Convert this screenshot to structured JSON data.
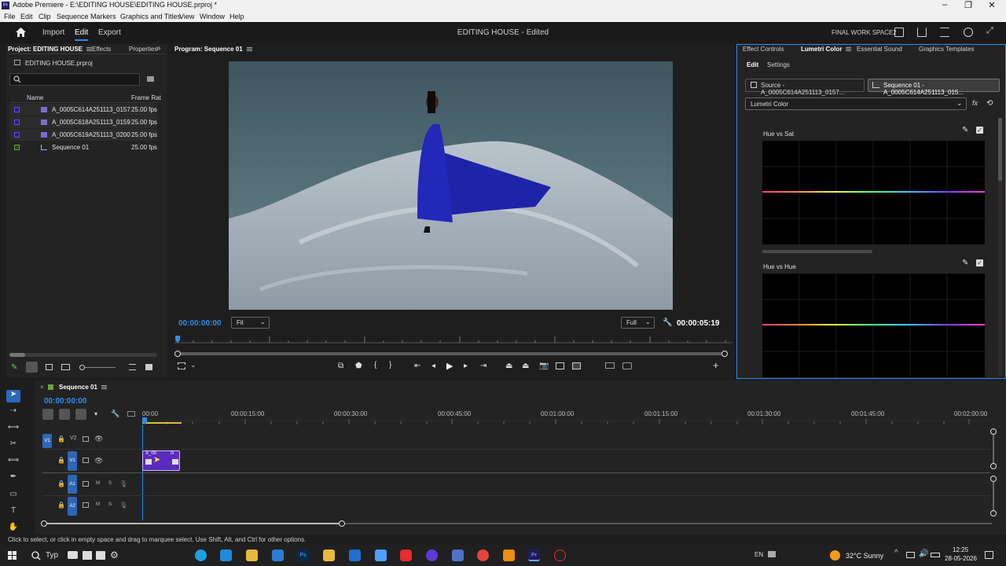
{
  "titlebar": {
    "app_icon": "Pr",
    "title": "Adobe Premiere - E:\\EDITING HOUSE\\EDITING HOUSE.prproj *"
  },
  "menubar": [
    "File",
    "Edit",
    "Clip",
    "Sequence",
    "Markers",
    "Graphics and Titles",
    "View",
    "Window",
    "Help"
  ],
  "header": {
    "nav": [
      "Import",
      "Edit",
      "Export"
    ],
    "active": "Edit",
    "project_title": "EDITING HOUSE",
    "project_state": "- Edited",
    "workspace": "FINAL WORK SPACE2"
  },
  "project_panel": {
    "tabs": [
      "Project: EDITING HOUSE",
      "Effects",
      "Properties"
    ],
    "file": "EDITING HOUSE.prproj",
    "columns": {
      "name": "Name",
      "frame_rate": "Frame Rat"
    },
    "items": [
      {
        "name": "A_0005C614A251113_0157",
        "fps": "25.00 fps"
      },
      {
        "name": "A_0005C618A251113_0159",
        "fps": "25.00 fps"
      },
      {
        "name": "A_0005C619A251113_0200",
        "fps": "25.00 fps"
      },
      {
        "name": "Sequence 01",
        "fps": "25.00 fps"
      }
    ]
  },
  "program_monitor": {
    "title": "Program: Sequence 01",
    "timecode": "00:00:00:00",
    "fit": "Fit",
    "quality": "Full",
    "duration": "00:00:05:19"
  },
  "lumetri": {
    "tabs": [
      "Effect Controls",
      "Lumetri Color",
      "Essential Sound",
      "Graphics Templates"
    ],
    "subtabs": [
      "Edit",
      "Settings"
    ],
    "source_tab": "Source - A_0005C614A251113_0157...",
    "sequence_tab": "Sequence 01 - A_0005C614A251113_015...",
    "effect": "Lumetri Color",
    "curves": [
      "Hue vs Sat",
      "Hue vs Hue"
    ]
  },
  "timeline": {
    "sequence": "Sequence 01",
    "timecode": "00:00:00:00",
    "ruler": [
      "00:00",
      "00:00:15:00",
      "00:00:30:00",
      "00:00:45:00",
      "00:01:00:00",
      "00:01:15:00",
      "00:01:30:00",
      "00:01:45:00",
      "00:02:00:00"
    ],
    "tracks": [
      "V2",
      "V1",
      "A1",
      "A2"
    ],
    "source_patch": [
      "V1",
      "A1"
    ],
    "clip_label": "A_00",
    "clip_fx": "fx"
  },
  "status": "Click to select, or click in empty space and drag to marquee select. Use Shift, Alt, and Ctrl for other options.",
  "taskbar": {
    "search": "Typ",
    "lang": "EN",
    "weather": "32°C Sunny",
    "time": "12:25",
    "date": "28-05-2026"
  }
}
